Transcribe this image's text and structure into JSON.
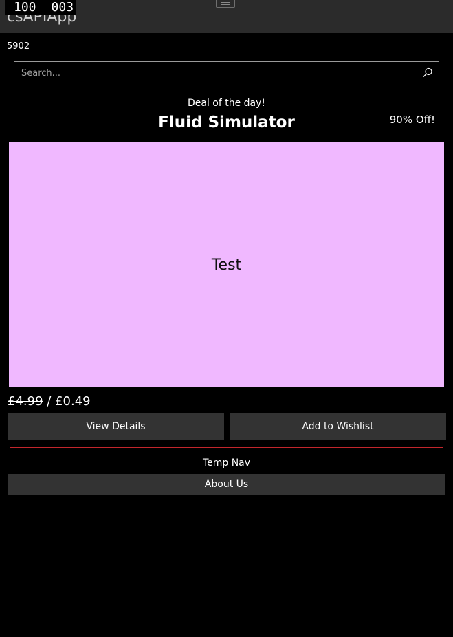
{
  "window": {
    "app_title": "csAPIApp",
    "fps_counter": [
      "100",
      "003"
    ]
  },
  "page": {
    "counter_text": "5902",
    "search": {
      "placeholder": "Search...",
      "value": ""
    },
    "deal": {
      "header": "Deal of the day!",
      "title": "Fluid Simulator",
      "discount": "90% Off!",
      "image_text": "Test",
      "old_price": "£4.99",
      "price_separator": " / ",
      "new_price": "£0.49",
      "view_details_label": "View Details",
      "wishlist_label": "Add to Wishlist"
    },
    "temp_nav": {
      "label": "Temp Nav",
      "about_label": "About Us"
    }
  },
  "colors": {
    "background": "#000000",
    "titlebar": "#2b2b2b",
    "button": "#333333",
    "image_placeholder": "#f0b8ff",
    "divider": "#c2262c"
  },
  "icons": {
    "search": "search-icon",
    "drag_handle": "drag-handle-icon"
  }
}
